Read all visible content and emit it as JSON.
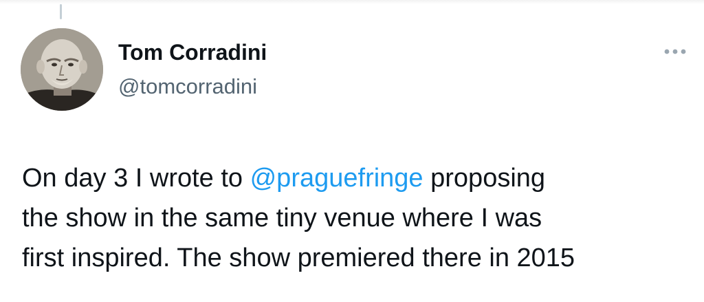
{
  "author": {
    "display_name": "Tom Corradini",
    "handle": "@tomcorradini",
    "avatar_icon": "person-photo-avatar"
  },
  "more_icon": "ellipsis-icon",
  "tweet": {
    "line1_before": "On day 3 I wrote to ",
    "mention": "@praguefringe",
    "line1_after": " proposing",
    "line2": "the show in the same tiny venue where I was",
    "line3": "first inspired. The show premiered there in 2015"
  },
  "colors": {
    "mention": "#1d9bf0",
    "handle": "#536471",
    "text": "#0f1419"
  }
}
